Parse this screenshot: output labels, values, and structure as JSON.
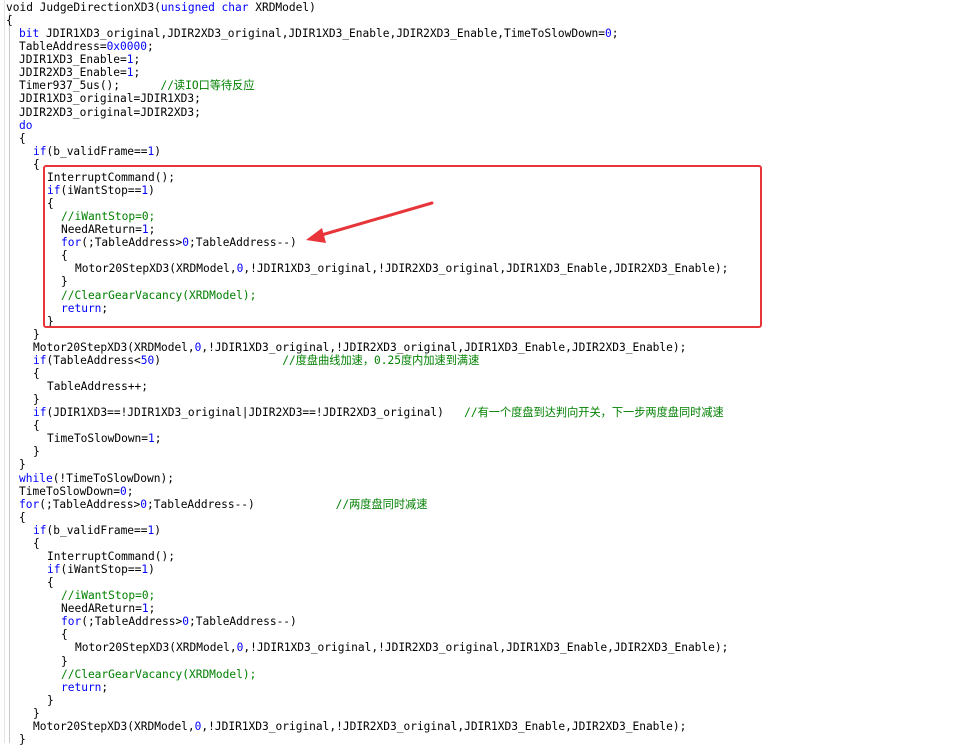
{
  "editor": {
    "lines": [
      [
        {
          "t": "void JudgeDirectionXD3(",
          "c": "plain"
        },
        {
          "t": "unsigned char",
          "c": "kw"
        },
        {
          "t": " XRDModel)",
          "c": "plain"
        }
      ],
      [
        {
          "t": "{",
          "c": "plain"
        }
      ],
      [
        {
          "t": "bit",
          "c": "kw"
        },
        {
          "t": " JDIR1XD3_original,JDIR2XD3_original,JDIR1XD3_Enable,JDIR2XD3_Enable,TimeToSlowDown=",
          "c": "plain"
        },
        {
          "t": "0",
          "c": "num"
        },
        {
          "t": ";",
          "c": "plain"
        }
      ],
      [
        {
          "t": "TableAddress=",
          "c": "plain"
        },
        {
          "t": "0x0000",
          "c": "num"
        },
        {
          "t": ";",
          "c": "plain"
        }
      ],
      [
        {
          "t": "JDIR1XD3_Enable=",
          "c": "plain"
        },
        {
          "t": "1",
          "c": "num"
        },
        {
          "t": ";",
          "c": "plain"
        }
      ],
      [
        {
          "t": "JDIR2XD3_Enable=",
          "c": "plain"
        },
        {
          "t": "1",
          "c": "num"
        },
        {
          "t": ";",
          "c": "plain"
        }
      ],
      [
        {
          "t": "Timer937_5us();      ",
          "c": "plain"
        },
        {
          "t": "//读IO口等待反应",
          "c": "cm"
        }
      ],
      [
        {
          "t": "JDIR1XD3_original=JDIR1XD3;",
          "c": "plain"
        }
      ],
      [
        {
          "t": "JDIR2XD3_original=JDIR2XD3;",
          "c": "plain"
        }
      ],
      [
        {
          "t": "do",
          "c": "kw"
        }
      ],
      [
        {
          "t": "{",
          "c": "plain"
        }
      ],
      [
        {
          "t": "if",
          "c": "kw"
        },
        {
          "t": "(b_validFrame==",
          "c": "plain"
        },
        {
          "t": "1",
          "c": "num"
        },
        {
          "t": ")",
          "c": "plain"
        }
      ],
      [
        {
          "t": "{",
          "c": "plain"
        }
      ],
      [
        {
          "t": "InterruptCommand();",
          "c": "plain"
        }
      ],
      [
        {
          "t": "if",
          "c": "kw"
        },
        {
          "t": "(iWantStop==",
          "c": "plain"
        },
        {
          "t": "1",
          "c": "num"
        },
        {
          "t": ")",
          "c": "plain"
        }
      ],
      [
        {
          "t": "{",
          "c": "plain"
        }
      ],
      [
        {
          "t": "//iWantStop=0;",
          "c": "cm"
        }
      ],
      [
        {
          "t": "NeedAReturn=",
          "c": "plain"
        },
        {
          "t": "1",
          "c": "num"
        },
        {
          "t": ";",
          "c": "plain"
        }
      ],
      [
        {
          "t": "for",
          "c": "kw"
        },
        {
          "t": "(;TableAddress>",
          "c": "plain"
        },
        {
          "t": "0",
          "c": "num"
        },
        {
          "t": ";TableAddress--)",
          "c": "plain"
        }
      ],
      [
        {
          "t": "{",
          "c": "plain"
        }
      ],
      [
        {
          "t": "Motor20StepXD3(XRDModel,",
          "c": "plain"
        },
        {
          "t": "0",
          "c": "num"
        },
        {
          "t": ",!JDIR1XD3_original,!JDIR2XD3_original,JDIR1XD3_Enable,JDIR2XD3_Enable);",
          "c": "plain"
        }
      ],
      [
        {
          "t": "}",
          "c": "plain"
        }
      ],
      [
        {
          "t": "//ClearGearVacancy(XRDModel);",
          "c": "cm"
        }
      ],
      [
        {
          "t": "return",
          "c": "kw"
        },
        {
          "t": ";",
          "c": "plain"
        }
      ],
      [
        {
          "t": "}",
          "c": "plain"
        }
      ],
      [
        {
          "t": "}",
          "c": "plain"
        }
      ],
      [
        {
          "t": "Motor20StepXD3(XRDModel,",
          "c": "plain"
        },
        {
          "t": "0",
          "c": "num"
        },
        {
          "t": ",!JDIR1XD3_original,!JDIR2XD3_original,JDIR1XD3_Enable,JDIR2XD3_Enable);",
          "c": "plain"
        }
      ],
      [
        {
          "t": "if",
          "c": "kw"
        },
        {
          "t": "(TableAddress<",
          "c": "plain"
        },
        {
          "t": "50",
          "c": "num"
        },
        {
          "t": ")                  ",
          "c": "plain"
        },
        {
          "t": "//度盘曲线加速，0.25度内加速到满速",
          "c": "cm"
        }
      ],
      [
        {
          "t": "{",
          "c": "plain"
        }
      ],
      [
        {
          "t": "TableAddress++;",
          "c": "plain"
        }
      ],
      [
        {
          "t": "}",
          "c": "plain"
        }
      ],
      [
        {
          "t": "if",
          "c": "kw"
        },
        {
          "t": "(JDIR1XD3==!JDIR1XD3_original|JDIR2XD3==!JDIR2XD3_original)   ",
          "c": "plain"
        },
        {
          "t": "//有一个度盘到达判向开关，下一步两度盘同时减速",
          "c": "cm"
        }
      ],
      [
        {
          "t": "{",
          "c": "plain"
        }
      ],
      [
        {
          "t": "TimeToSlowDown=",
          "c": "plain"
        },
        {
          "t": "1",
          "c": "num"
        },
        {
          "t": ";",
          "c": "plain"
        }
      ],
      [
        {
          "t": "}",
          "c": "plain"
        }
      ],
      [
        {
          "t": "}",
          "c": "plain"
        }
      ],
      [
        {
          "t": "while",
          "c": "kw"
        },
        {
          "t": "(!TimeToSlowDown);",
          "c": "plain"
        }
      ],
      [
        {
          "t": "TimeToSlowDown=",
          "c": "plain"
        },
        {
          "t": "0",
          "c": "num"
        },
        {
          "t": ";",
          "c": "plain"
        }
      ],
      [
        {
          "t": "for",
          "c": "kw"
        },
        {
          "t": "(;TableAddress>",
          "c": "plain"
        },
        {
          "t": "0",
          "c": "num"
        },
        {
          "t": ";TableAddress--)            ",
          "c": "plain"
        },
        {
          "t": "//两度盘同时减速",
          "c": "cm"
        }
      ],
      [
        {
          "t": "{",
          "c": "plain"
        }
      ],
      [
        {
          "t": "if",
          "c": "kw"
        },
        {
          "t": "(b_validFrame==",
          "c": "plain"
        },
        {
          "t": "1",
          "c": "num"
        },
        {
          "t": ")",
          "c": "plain"
        }
      ],
      [
        {
          "t": "{",
          "c": "plain"
        }
      ],
      [
        {
          "t": "InterruptCommand();",
          "c": "plain"
        }
      ],
      [
        {
          "t": "if",
          "c": "kw"
        },
        {
          "t": "(iWantStop==",
          "c": "plain"
        },
        {
          "t": "1",
          "c": "num"
        },
        {
          "t": ")",
          "c": "plain"
        }
      ],
      [
        {
          "t": "{",
          "c": "plain"
        }
      ],
      [
        {
          "t": "//iWantStop=0;",
          "c": "cm"
        }
      ],
      [
        {
          "t": "NeedAReturn=",
          "c": "plain"
        },
        {
          "t": "1",
          "c": "num"
        },
        {
          "t": ";",
          "c": "plain"
        }
      ],
      [
        {
          "t": "for",
          "c": "kw"
        },
        {
          "t": "(;TableAddress>",
          "c": "plain"
        },
        {
          "t": "0",
          "c": "num"
        },
        {
          "t": ";TableAddress--)",
          "c": "plain"
        }
      ],
      [
        {
          "t": "{",
          "c": "plain"
        }
      ],
      [
        {
          "t": "Motor20StepXD3(XRDModel,",
          "c": "plain"
        },
        {
          "t": "0",
          "c": "num"
        },
        {
          "t": ",!JDIR1XD3_original,!JDIR2XD3_original,JDIR1XD3_Enable,JDIR2XD3_Enable);",
          "c": "plain"
        }
      ],
      [
        {
          "t": "}",
          "c": "plain"
        }
      ],
      [
        {
          "t": "//ClearGearVacancy(XRDModel);",
          "c": "cm"
        }
      ],
      [
        {
          "t": "return",
          "c": "kw"
        },
        {
          "t": ";",
          "c": "plain"
        }
      ],
      [
        {
          "t": "}",
          "c": "plain"
        }
      ],
      [
        {
          "t": "}",
          "c": "plain"
        }
      ],
      [
        {
          "t": "Motor20StepXD3(XRDModel,",
          "c": "plain"
        },
        {
          "t": "0",
          "c": "num"
        },
        {
          "t": ",!JDIR1XD3_original,!JDIR2XD3_original,JDIR1XD3_Enable,JDIR2XD3_Enable);",
          "c": "plain"
        }
      ],
      [
        {
          "t": "}",
          "c": "plain"
        }
      ]
    ]
  },
  "colors": {
    "keyword": "#0000ff",
    "comment": "#008000",
    "text": "#000000",
    "annotation": "#e8353a"
  }
}
